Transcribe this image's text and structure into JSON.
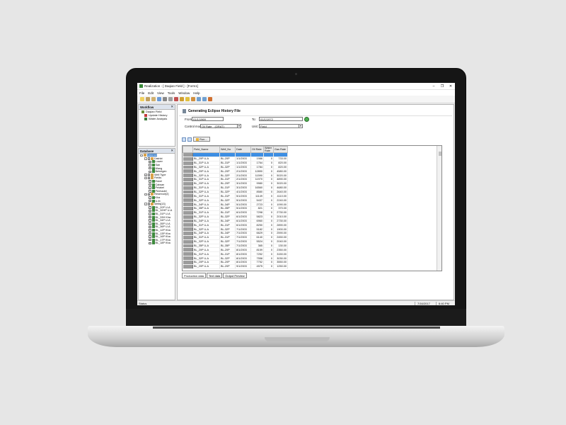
{
  "window": {
    "title": "Realization - [ Daqian Field ] - [Form1]",
    "min": "–",
    "max": "❐",
    "close": "✕"
  },
  "menu": [
    "File",
    "Edit",
    "View",
    "Tools",
    "Window",
    "Help"
  ],
  "workflow": {
    "title": "Workflow",
    "items": [
      {
        "label": "Daqian Field",
        "child": false,
        "color": "#6a8f3a"
      },
      {
        "label": "Update History",
        "child": true,
        "color": "#c23b3b"
      },
      {
        "label": "Water Analysis",
        "child": true,
        "color": "#3a7a3a"
      }
    ]
  },
  "database": {
    "title": "Database",
    "tree": [
      {
        "label": "Dataroot",
        "indent": 0,
        "cb": false,
        "selected": true,
        "exp": "-"
      },
      {
        "label": "District",
        "indent": 1,
        "cb": true,
        "exp": "-"
      },
      {
        "label": "Lower",
        "indent": 2,
        "cb": true,
        "on": true
      },
      {
        "label": "San",
        "indent": 2,
        "cb": true
      },
      {
        "label": "Wang",
        "indent": 2,
        "cb": true
      },
      {
        "label": "Beheigen",
        "indent": 2,
        "cb": true
      },
      {
        "label": "Well Type",
        "indent": 1,
        "cb": true,
        "exp": "+"
      },
      {
        "label": "Fields",
        "indent": 1,
        "cb": true,
        "exp": "-"
      },
      {
        "label": "Eskel",
        "indent": 2,
        "cb": true,
        "on": true
      },
      {
        "label": "Caiwan",
        "indent": 2,
        "cb": true
      },
      {
        "label": "Peiakel",
        "indent": 2,
        "cb": true
      },
      {
        "label": "Penhadel",
        "indent": 2,
        "cb": true
      },
      {
        "label": "Reservoir[2]",
        "indent": 1,
        "cb": true,
        "exp": "-"
      },
      {
        "label": "Kha",
        "indent": 2,
        "cb": true
      },
      {
        "label": "U-Ib",
        "indent": 2,
        "cb": true
      },
      {
        "label": "Wells[13]",
        "indent": 1,
        "cb": true,
        "exp": "-"
      },
      {
        "label": "BL_20P U-A",
        "indent": 2,
        "cb": true
      },
      {
        "label": "BL_32HP U-A",
        "indent": 2,
        "cb": true
      },
      {
        "label": "BL_31P U-A",
        "indent": 2,
        "cb": true
      },
      {
        "label": "BL_33H Kha",
        "indent": 2,
        "cb": true
      },
      {
        "label": "BL_34P U-A",
        "indent": 2,
        "cb": true
      },
      {
        "label": "BL_35P U-A",
        "indent": 2,
        "cb": true
      },
      {
        "label": "BL_36P U-A",
        "indent": 2,
        "cb": true
      },
      {
        "label": "BL_12P Kha",
        "indent": 2,
        "cb": true
      },
      {
        "label": "BL_13P Kha",
        "indent": 2,
        "cb": true
      },
      {
        "label": "BL_16P Kha",
        "indent": 2,
        "cb": true
      },
      {
        "label": "BL_17P Kha",
        "indent": 2,
        "cb": true
      },
      {
        "label": "BL_18P Kha",
        "indent": 2,
        "cb": true
      }
    ]
  },
  "doc": {
    "title": "Generating Eclipse History File",
    "from_label": "From:",
    "from_value": "01/1/1969",
    "to_label": "To:",
    "to_value": "01/1/1972",
    "control_label": "Control mode:",
    "control_value": "Oil Rate",
    "control_unit": "(ORAT)",
    "unit_label": "Unit:",
    "unit_value": "Field",
    "run_label": "Run..."
  },
  "grid": {
    "columns": [
      "Field_Name",
      "Well_No",
      "Date",
      "Oil Rate",
      "Water Rate",
      "Gas Rate"
    ],
    "rows": [
      [
        "",
        "",
        "",
        "",
        "",
        ""
      ],
      [
        "BL_20P U-A",
        "BL-20P",
        "1/1/2003",
        "1986",
        "0",
        "733.00"
      ],
      [
        "BL_31P U-A",
        "BL-31P",
        "1/1/2003",
        "1764",
        "0",
        "820.00"
      ],
      [
        "BL_32P U-A",
        "BL-32P",
        "1/1/2003",
        "1784",
        "0",
        "820.00"
      ],
      [
        "BL_20P U-A",
        "BL-20P",
        "2/1/2003",
        "12890",
        "0",
        "4580.00"
      ],
      [
        "BL_32P U-A",
        "BL-32P",
        "2/1/2003",
        "11590",
        "0",
        "5020.00"
      ],
      [
        "BL_31P U-A",
        "BL-31P",
        "2/1/2003",
        "11970",
        "0",
        "4890.00"
      ],
      [
        "BL_20P U-A",
        "BL-20P",
        "3/1/2003",
        "9980",
        "0",
        "3020.00"
      ],
      [
        "BL_31P U-A",
        "BL-31P",
        "3/1/2003",
        "16560",
        "0",
        "4680.00"
      ],
      [
        "BL_32P U-A",
        "BL-32P",
        "4/1/2003",
        "8580",
        "0",
        "2640.00"
      ],
      [
        "BL_31P U-A",
        "BL-31P",
        "5/1/2003",
        "11149",
        "0",
        "4110.00"
      ],
      [
        "BL_32P U-A",
        "BL-32P",
        "5/1/2003",
        "5437",
        "0",
        "2240.00"
      ],
      [
        "BL_34P U-A",
        "BL-34P",
        "5/1/2003",
        "2723",
        "0",
        "1090.00"
      ],
      [
        "BL_35P U-A",
        "BL-35P",
        "5/1/2003",
        "821",
        "0",
        "370.00"
      ],
      [
        "BL_31P U-A",
        "BL-31P",
        "6/1/2003",
        "7298",
        "0",
        "2730.00"
      ],
      [
        "BL_32P U-A",
        "BL-32P",
        "6/1/2003",
        "5823",
        "0",
        "2010.00"
      ],
      [
        "BL_34P U-A",
        "BL-34P",
        "6/1/2003",
        "6960",
        "0",
        "2730.00"
      ],
      [
        "BL_31P U-A",
        "BL-31P",
        "6/1/2003",
        "8250",
        "0",
        "2890.00"
      ],
      [
        "BL_32P U-A",
        "BL-32P",
        "7/1/2003",
        "5182",
        "0",
        "1900.00"
      ],
      [
        "BL_34P U-A",
        "BL-34P",
        "7/1/2003",
        "6629",
        "0",
        "2590.00"
      ],
      [
        "BL_31P U-A",
        "BL-31P",
        "7/1/2003",
        "6140",
        "0",
        "2450.00"
      ],
      [
        "BL_32P U-A",
        "BL-32P",
        "7/1/2003",
        "5524",
        "0",
        "2040.00"
      ],
      [
        "BL_35P U-A",
        "BL-35P",
        "7/1/2003",
        "365",
        "0",
        "130.00"
      ],
      [
        "BL_20P U-A",
        "BL-20P",
        "8/1/2003",
        "8159",
        "0",
        "2350.00"
      ],
      [
        "BL_31P U-A",
        "BL-31P",
        "8/1/2003",
        "7252",
        "0",
        "3150.00"
      ],
      [
        "BL_32P U-A",
        "BL-32P",
        "8/1/2003",
        "7558",
        "0",
        "3030.00"
      ],
      [
        "BL_20P U-A",
        "BL-20P",
        "8/1/2003",
        "7752",
        "0",
        "3550.00"
      ],
      [
        "BL_20P U-A",
        "BL-20P",
        "9/1/2003",
        "4575",
        "0",
        "1250.00"
      ]
    ]
  },
  "tabs": [
    "Production data",
    "Text data",
    "Output Preview"
  ],
  "status": {
    "left": "Status",
    "date": "7/16/2017",
    "time": "6:40 PM"
  }
}
